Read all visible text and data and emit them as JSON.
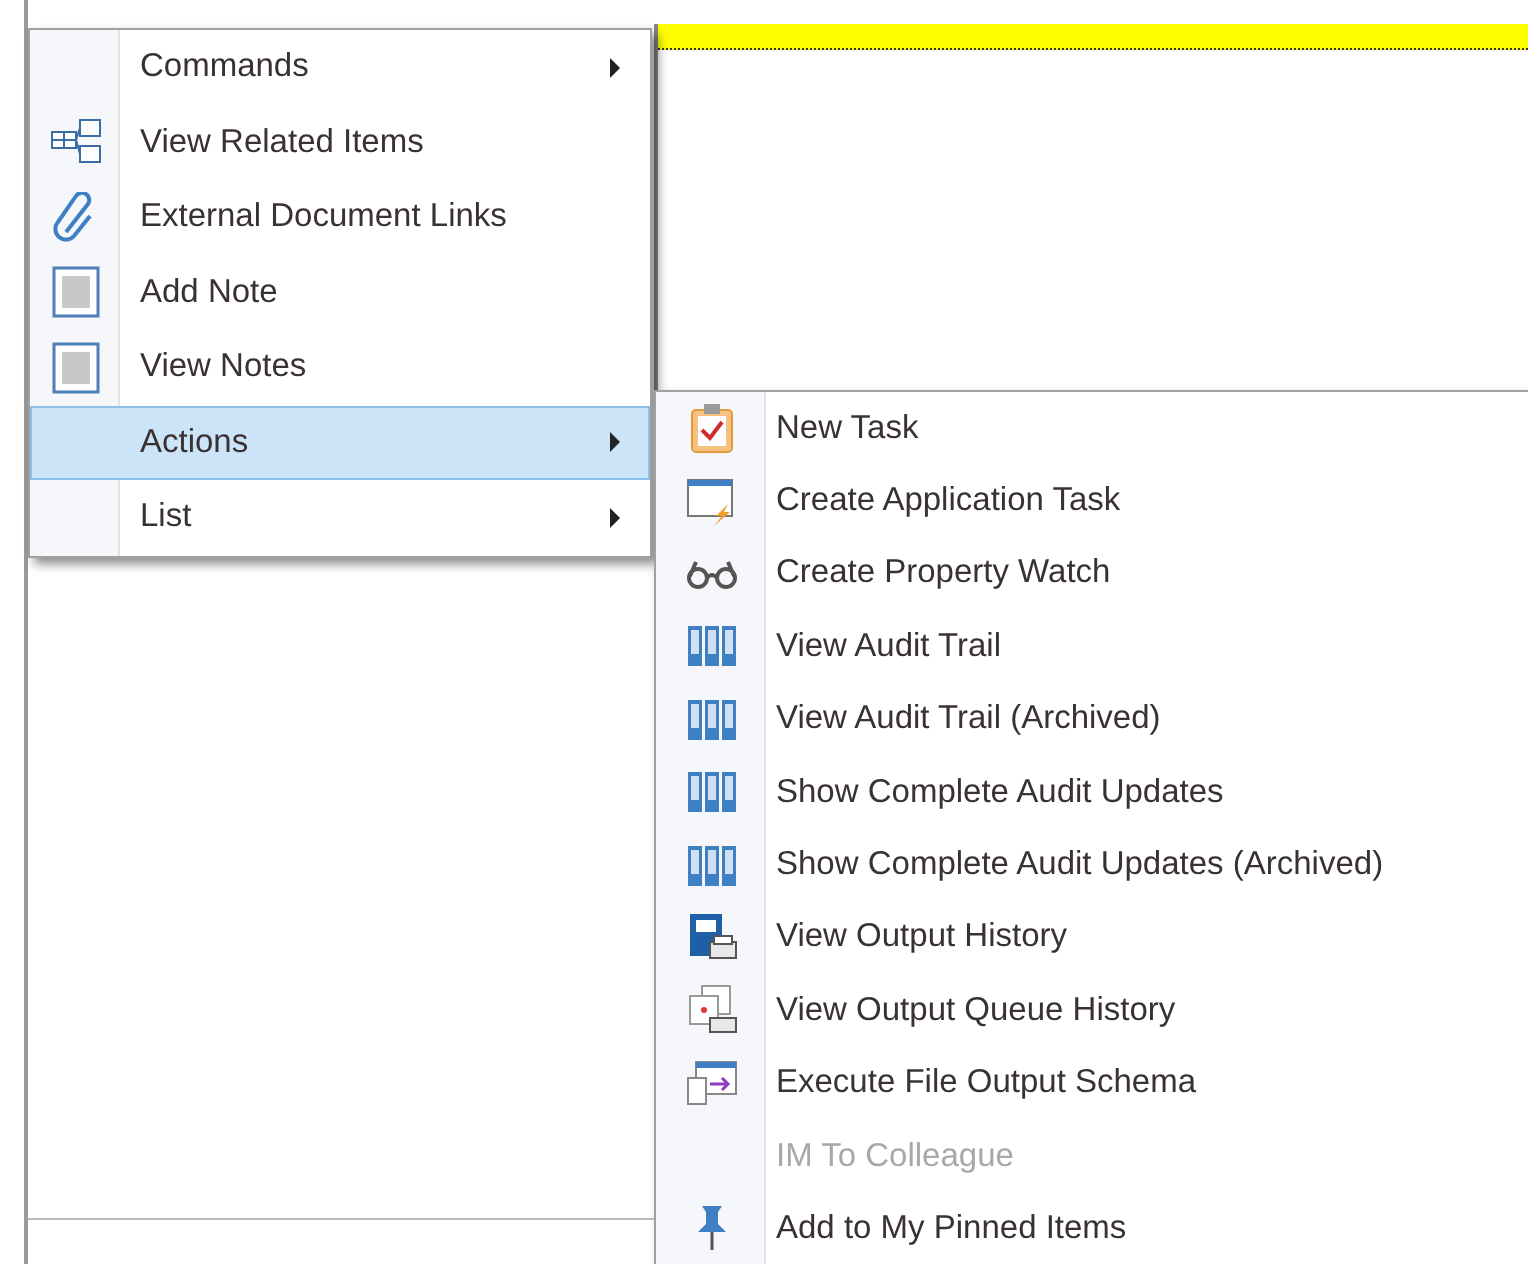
{
  "context_menu": {
    "items": [
      {
        "label": "Commands",
        "has_submenu": true,
        "selected": false,
        "disabled": false
      },
      {
        "label": "View Related Items",
        "has_submenu": false,
        "selected": false,
        "disabled": false
      },
      {
        "label": "External Document Links",
        "has_submenu": false,
        "selected": false,
        "disabled": false
      },
      {
        "label": "Add Note",
        "has_submenu": false,
        "selected": false,
        "disabled": false
      },
      {
        "label": "View Notes",
        "has_submenu": false,
        "selected": false,
        "disabled": false
      },
      {
        "label": "Actions",
        "has_submenu": true,
        "selected": true,
        "disabled": false
      },
      {
        "label": "List",
        "has_submenu": true,
        "selected": false,
        "disabled": false
      }
    ]
  },
  "actions_submenu": {
    "items": [
      {
        "label": "New Task",
        "selected": false,
        "disabled": false
      },
      {
        "label": "Create Application Task",
        "selected": false,
        "disabled": false
      },
      {
        "label": "Create Property Watch",
        "selected": false,
        "disabled": false
      },
      {
        "label": "View Audit Trail",
        "selected": false,
        "disabled": false
      },
      {
        "label": "View Audit Trail (Archived)",
        "selected": false,
        "disabled": false
      },
      {
        "label": "Show Complete Audit Updates",
        "selected": false,
        "disabled": false
      },
      {
        "label": "Show Complete Audit Updates (Archived)",
        "selected": false,
        "disabled": false
      },
      {
        "label": "View Output History",
        "selected": false,
        "disabled": false
      },
      {
        "label": "View Output Queue History",
        "selected": false,
        "disabled": false
      },
      {
        "label": "Execute File Output Schema",
        "selected": false,
        "disabled": false
      },
      {
        "label": "IM To Colleague",
        "selected": false,
        "disabled": true
      },
      {
        "label": "Add to My Pinned Items",
        "selected": false,
        "disabled": false
      }
    ]
  }
}
